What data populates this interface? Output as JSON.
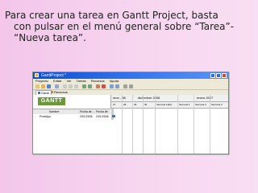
{
  "caption": {
    "line1": "Para crear una tarea en Gantt Project, basta",
    "line2": "con pulsar en el menú general sobre “Tarea”-",
    "line3": "“Nueva tarea”."
  },
  "window": {
    "title": "GanttProject *"
  },
  "menu": [
    "Proyecto",
    "Editar",
    "Ver",
    "Tareas",
    "Recursos",
    "Ayuda"
  ],
  "tabs": {
    "gantt": "Gantt",
    "resources": "Recursos"
  },
  "logo": "GANTT",
  "task_table": {
    "columns": [
      "Nombre",
      "Fecha de ...",
      "Fecha de ..."
    ],
    "row": {
      "name": "Prototipo",
      "start": "2/01/2006",
      "end": "2/01/2006"
    }
  },
  "timeline": {
    "week_label": "mon - 36",
    "month1": "diciembre 2006",
    "month2": "enero 2007",
    "days": [
      "27",
      "28",
      "29",
      "30",
      "Semana 1(E1)",
      "Semana 1",
      "Semana 2",
      "Semana 3"
    ]
  },
  "colors": {
    "title_bar": "#0a4fd0",
    "logo_bg": "#6a9a3a",
    "task_bar": "#4a6fb5"
  }
}
